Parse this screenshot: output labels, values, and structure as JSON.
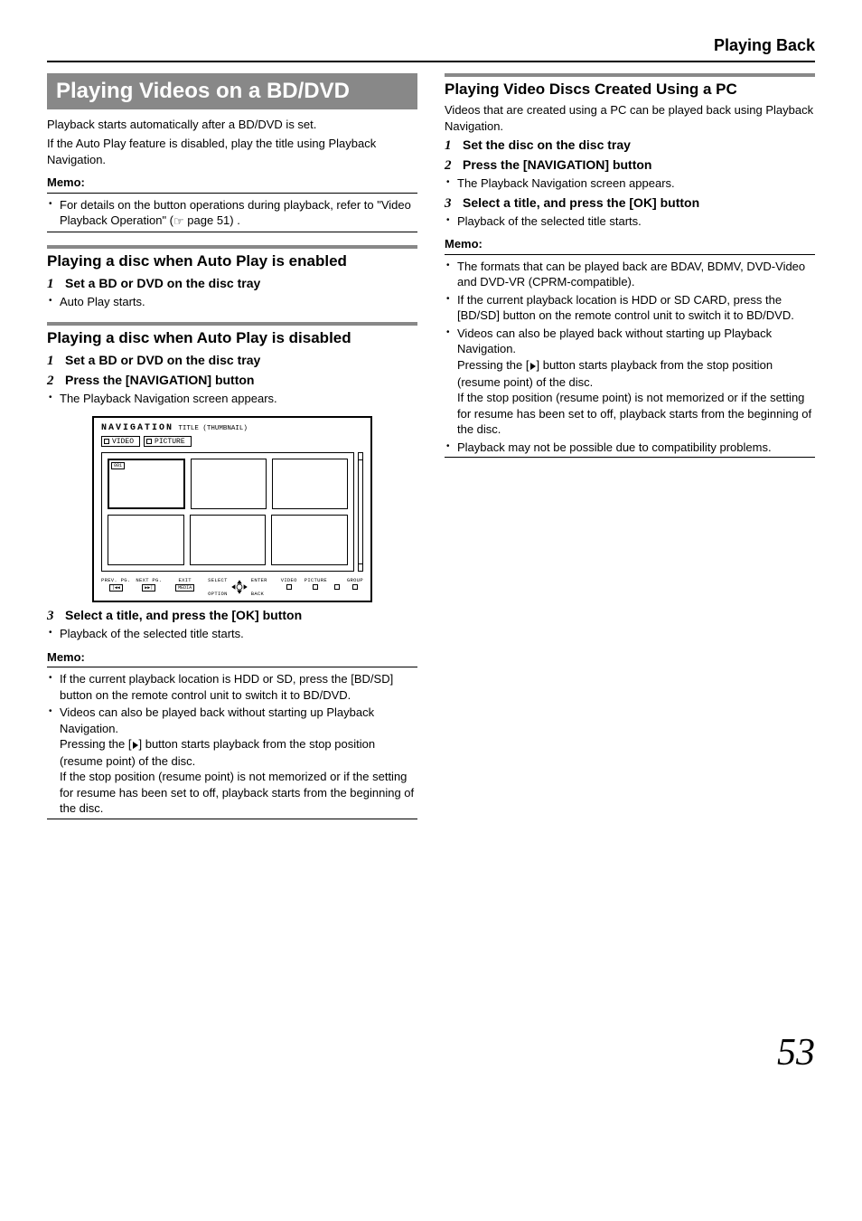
{
  "header": {
    "title": "Playing Back"
  },
  "left": {
    "main_heading": "Playing Videos on a BD/DVD",
    "intro1": "Playback starts automatically after a BD/DVD is set.",
    "intro2": "If the Auto Play feature is disabled, play the title using Playback Navigation.",
    "memo_label": "Memo:",
    "memo1_a": "For details on the button operations during playback, refer to \"Video Playback Operation\" (",
    "memo1_b": " page 51) .",
    "sec1": {
      "h": "Playing a disc when Auto Play is enabled",
      "step1": "Set a BD or DVD on the disc tray",
      "b1": "Auto Play starts."
    },
    "sec2": {
      "h": "Playing a disc when Auto Play is disabled",
      "step1": "Set a BD or DVD on the disc tray",
      "step2": "Press the [NAVIGATION] button",
      "b1": "The Playback Navigation screen appears."
    },
    "screen": {
      "nav": "NAVIGATION",
      "nav_sub": "TITLE (THUMBNAIL)",
      "tab1": "VIDEO",
      "tab2": "PICTURE",
      "badge": "001",
      "l_prev": "PREV. PG.",
      "l_next": "NEXT PG.",
      "l_exit": "EXIT",
      "b_prev": "|◀◀",
      "b_next": "▶▶|",
      "b_exit": "MEDIA",
      "l_select": "SELECT",
      "l_enter": "ENTER",
      "l_option": "OPTION",
      "l_back": "BACK",
      "c_video": "VIDEO",
      "c_picture": "PICTURE",
      "c_blank": "",
      "c_group": "GROUP"
    },
    "sec3": {
      "step3": "Select a title, and press the [OK] button",
      "b1": "Playback of the selected title starts."
    },
    "memo2": {
      "label": "Memo:",
      "b1": "If the current playback location is HDD or SD, press the [BD/SD] button on the remote control unit to switch it to BD/DVD.",
      "b2a": "Videos can also be played back without starting up Playback Navigation.",
      "b2b_a": "Pressing the [",
      "b2b_b": "] button starts playback from the stop position (resume point) of the disc.",
      "b2c": "If the stop position (resume point) is not memorized or if the setting for resume has been set to off, playback starts from the beginning of the disc."
    }
  },
  "right": {
    "h": "Playing Video Discs Created Using a PC",
    "intro": "Videos that are created using a PC can be played back using Playback Navigation.",
    "step1": "Set the disc on the disc tray",
    "step2": "Press the [NAVIGATION] button",
    "b1": "The Playback Navigation screen appears.",
    "step3": "Select a title, and press the [OK] button",
    "b2": "Playback of the selected title starts.",
    "memo_label": "Memo:",
    "m1": "The formats that can be played back are BDAV, BDMV, DVD-Video and DVD-VR (CPRM-compatible).",
    "m2": "If the current playback location is HDD or SD CARD, press the [BD/SD] button on the remote control unit to switch it to BD/DVD.",
    "m3a": "Videos can also be played back without starting up Playback Navigation.",
    "m3b_a": "Pressing the [",
    "m3b_b": "] button starts playback from the stop position (resume point) of the disc.",
    "m3c": "If the stop position (resume point) is not memorized or if the setting for resume has been set to off, playback starts from the beginning of the disc.",
    "m4": "Playback may not be possible due to compatibility problems."
  },
  "page_number": "53"
}
